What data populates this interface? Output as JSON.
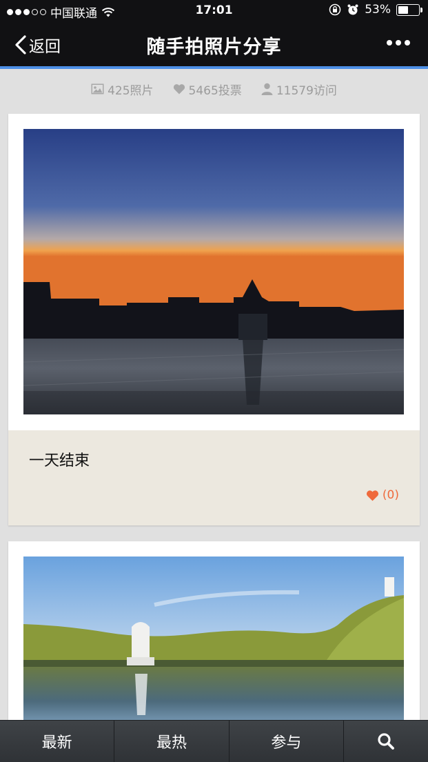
{
  "status_bar": {
    "carrier": "中国联通",
    "time": "17:01",
    "battery": "53%",
    "battery_level": 0.53
  },
  "nav": {
    "back_label": "返回",
    "title": "随手拍照片分享"
  },
  "stats": {
    "photos": "425照片",
    "votes": "5465投票",
    "visits": "11579访问"
  },
  "cards": [
    {
      "caption": "一天结束",
      "likes": "(0)"
    }
  ],
  "tabs": {
    "latest": "最新",
    "hottest": "最热",
    "join": "参与"
  },
  "icons": {
    "photo": "image-icon",
    "vote": "heart-icon",
    "visit": "user-icon",
    "search": "search-icon",
    "back": "chevron-left-icon",
    "more": "more-icon"
  },
  "colors": {
    "accent_line": "#4d8fe6",
    "like": "#ef6a3c",
    "caption_bg": "#ece8df"
  }
}
